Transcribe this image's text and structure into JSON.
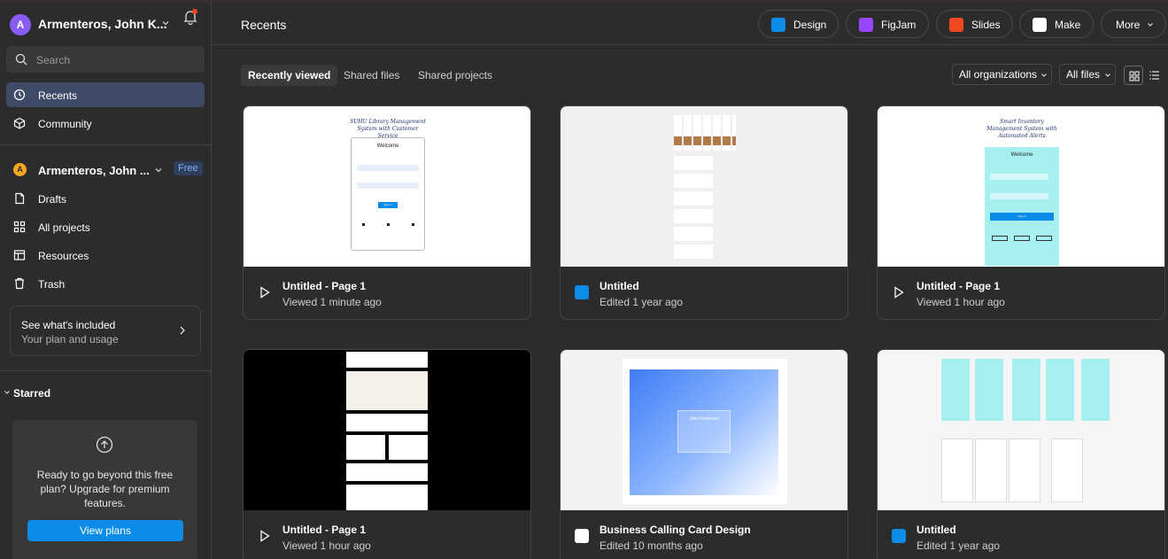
{
  "sidebar": {
    "account": {
      "initial": "A",
      "name": "Armenteros, John K..."
    },
    "search": {
      "placeholder": "Search"
    },
    "nav": [
      {
        "label": "Recents",
        "icon": "clock-icon",
        "active": true
      },
      {
        "label": "Community",
        "icon": "cube-icon",
        "active": false
      }
    ],
    "team": {
      "initial": "A",
      "name": "Armenteros, John ...",
      "badge": "Free"
    },
    "team_nav": [
      {
        "label": "Drafts",
        "icon": "file-icon"
      },
      {
        "label": "All projects",
        "icon": "grid-icon"
      },
      {
        "label": "Resources",
        "icon": "layout-icon"
      },
      {
        "label": "Trash",
        "icon": "trash-icon"
      }
    ],
    "plan_card": {
      "title": "See what's included",
      "subtitle": "Your plan and usage"
    },
    "starred_label": "Starred",
    "upgrade": {
      "text": "Ready to go beyond this free plan? Upgrade for premium features.",
      "button": "View plans"
    }
  },
  "header": {
    "title": "Recents",
    "pills": [
      {
        "label": "Design",
        "icon": "design-icon",
        "color": "#0c8ce9"
      },
      {
        "label": "FigJam",
        "icon": "figjam-icon",
        "color": "#9747ff"
      },
      {
        "label": "Slides",
        "icon": "slides-icon",
        "color": "#f24822"
      },
      {
        "label": "Make",
        "icon": "make-icon",
        "color": "#ffffff"
      },
      {
        "label": "More",
        "icon": "chevron-down-icon",
        "color": ""
      }
    ]
  },
  "tabs": [
    "Recently viewed",
    "Shared files",
    "Shared projects"
  ],
  "filters": {
    "org": "All organizations",
    "files": "All files"
  },
  "thumb_text": {
    "t1_title": "SUHU Library Management System with Customer Service",
    "t1_welcome": "Welcome",
    "t1_signin": "Sign in",
    "t3_title": "Smart Inventory Management System with Automated Alerts",
    "t3_welcome": "Welcome",
    "t3_signin": "Sign in",
    "t5_name": "John Anderson"
  },
  "files": [
    {
      "title": "Untitled - Page 1",
      "subtitle": "Viewed 1 minute ago",
      "icon": "play-icon"
    },
    {
      "title": "Untitled",
      "subtitle": "Edited 1 year ago",
      "icon": "design-icon"
    },
    {
      "title": "Untitled - Page 1",
      "subtitle": "Viewed 1 hour ago",
      "icon": "play-icon"
    },
    {
      "title": "Untitled - Page 1",
      "subtitle": "Viewed 1 hour ago",
      "icon": "play-icon"
    },
    {
      "title": "Business Calling Card Design",
      "subtitle": "Edited 10 months ago",
      "icon": "make-icon"
    },
    {
      "title": "Untitled",
      "subtitle": "Edited 1 year ago",
      "icon": "design-icon"
    }
  ],
  "colors": {
    "accent": "#0c8ce9",
    "active_nav": "#3e4a66"
  }
}
